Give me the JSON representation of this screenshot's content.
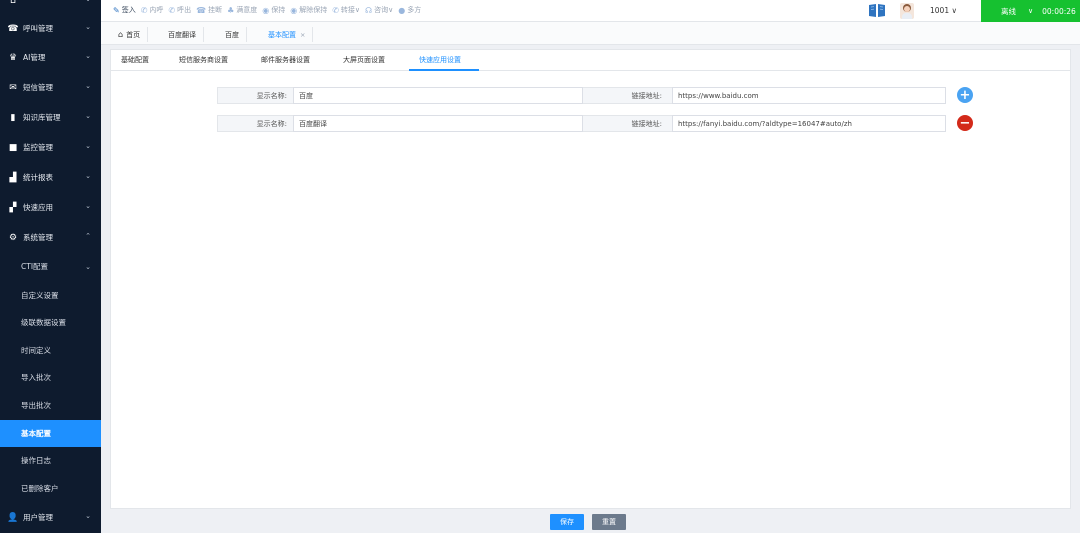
{
  "sidebar": {
    "items": [
      {
        "label": "",
        "icon": "home-icon",
        "chevron": "⌄"
      },
      {
        "label": "呼叫管理",
        "icon": "phone-icon",
        "chevron": "⌄"
      },
      {
        "label": "AI管理",
        "icon": "robot-icon",
        "chevron": "⌄"
      },
      {
        "label": "短信管理",
        "icon": "mail-icon",
        "chevron": "⌄"
      },
      {
        "label": "知识库管理",
        "icon": "book-icon",
        "chevron": "⌄"
      },
      {
        "label": "监控管理",
        "icon": "camera-icon",
        "chevron": "⌄"
      },
      {
        "label": "统计报表",
        "icon": "bar-chart-icon",
        "chevron": "⌄"
      },
      {
        "label": "快速应用",
        "icon": "grid-icon",
        "chevron": "⌄"
      },
      {
        "label": "系统管理",
        "icon": "gear-icon",
        "chevron": "⌃"
      }
    ],
    "sub_items": [
      {
        "label": "CTI配置",
        "chevron": "⌄"
      },
      {
        "label": "自定义设置"
      },
      {
        "label": "级联数据设置"
      },
      {
        "label": "时间定义"
      },
      {
        "label": "导入批次"
      },
      {
        "label": "导出批次"
      },
      {
        "label": "基本配置",
        "active": true
      },
      {
        "label": "操作日志"
      },
      {
        "label": "已删除客户"
      }
    ],
    "bottom_item": {
      "label": "用户管理",
      "icon": "user-icon",
      "chevron": "⌄"
    }
  },
  "toolbar": {
    "tools": [
      {
        "label": "签入",
        "icon": "pen-icon"
      },
      {
        "label": "内呼",
        "icon": "phone-icon"
      },
      {
        "label": "呼出",
        "icon": "phone-out-icon"
      },
      {
        "label": "挂断",
        "icon": "hangup-icon"
      },
      {
        "label": "满意度",
        "icon": "thumb-icon"
      },
      {
        "label": "保持",
        "icon": "pause-icon"
      },
      {
        "label": "解除保持",
        "icon": "play-icon"
      },
      {
        "label": "转接∨",
        "icon": "transfer-icon"
      },
      {
        "label": "咨询∨",
        "icon": "headset-icon"
      },
      {
        "label": "多方",
        "icon": "chat-icon"
      }
    ],
    "agent_id": "1001 ∨",
    "status_label": "离线",
    "status_chevron": "∨",
    "status_time": "00:00:26",
    "status_color": "#16c130"
  },
  "tabs": [
    {
      "label": "首页",
      "icon": "home-icon"
    },
    {
      "label": "百度翻译"
    },
    {
      "label": "百度"
    },
    {
      "label": "基本配置",
      "active": true,
      "close": "×"
    }
  ],
  "subtabs": [
    {
      "label": "基础配置"
    },
    {
      "label": "短信服务商设置"
    },
    {
      "label": "邮件服务器设置"
    },
    {
      "label": "大屏页面设置"
    },
    {
      "label": "快速应用设置",
      "active": true
    }
  ],
  "form": {
    "rows": [
      {
        "name_label": "显示名称:",
        "name_value": "百度",
        "url_label": "链接地址:",
        "url_value": "https://www.baidu.com",
        "action": "+"
      },
      {
        "name_label": "显示名称:",
        "name_value": "百度翻译",
        "url_label": "链接地址:",
        "url_value": "https://fanyi.baidu.com/?aldtype=16047#auto/zh",
        "action": "−"
      }
    ]
  },
  "buttons": {
    "save": "保存",
    "reset": "重置"
  },
  "colors": {
    "accent": "#1e90ff",
    "sidebar_bg": "#0e1b2e",
    "remove": "#d32a1a",
    "add": "#4aa3f2"
  }
}
